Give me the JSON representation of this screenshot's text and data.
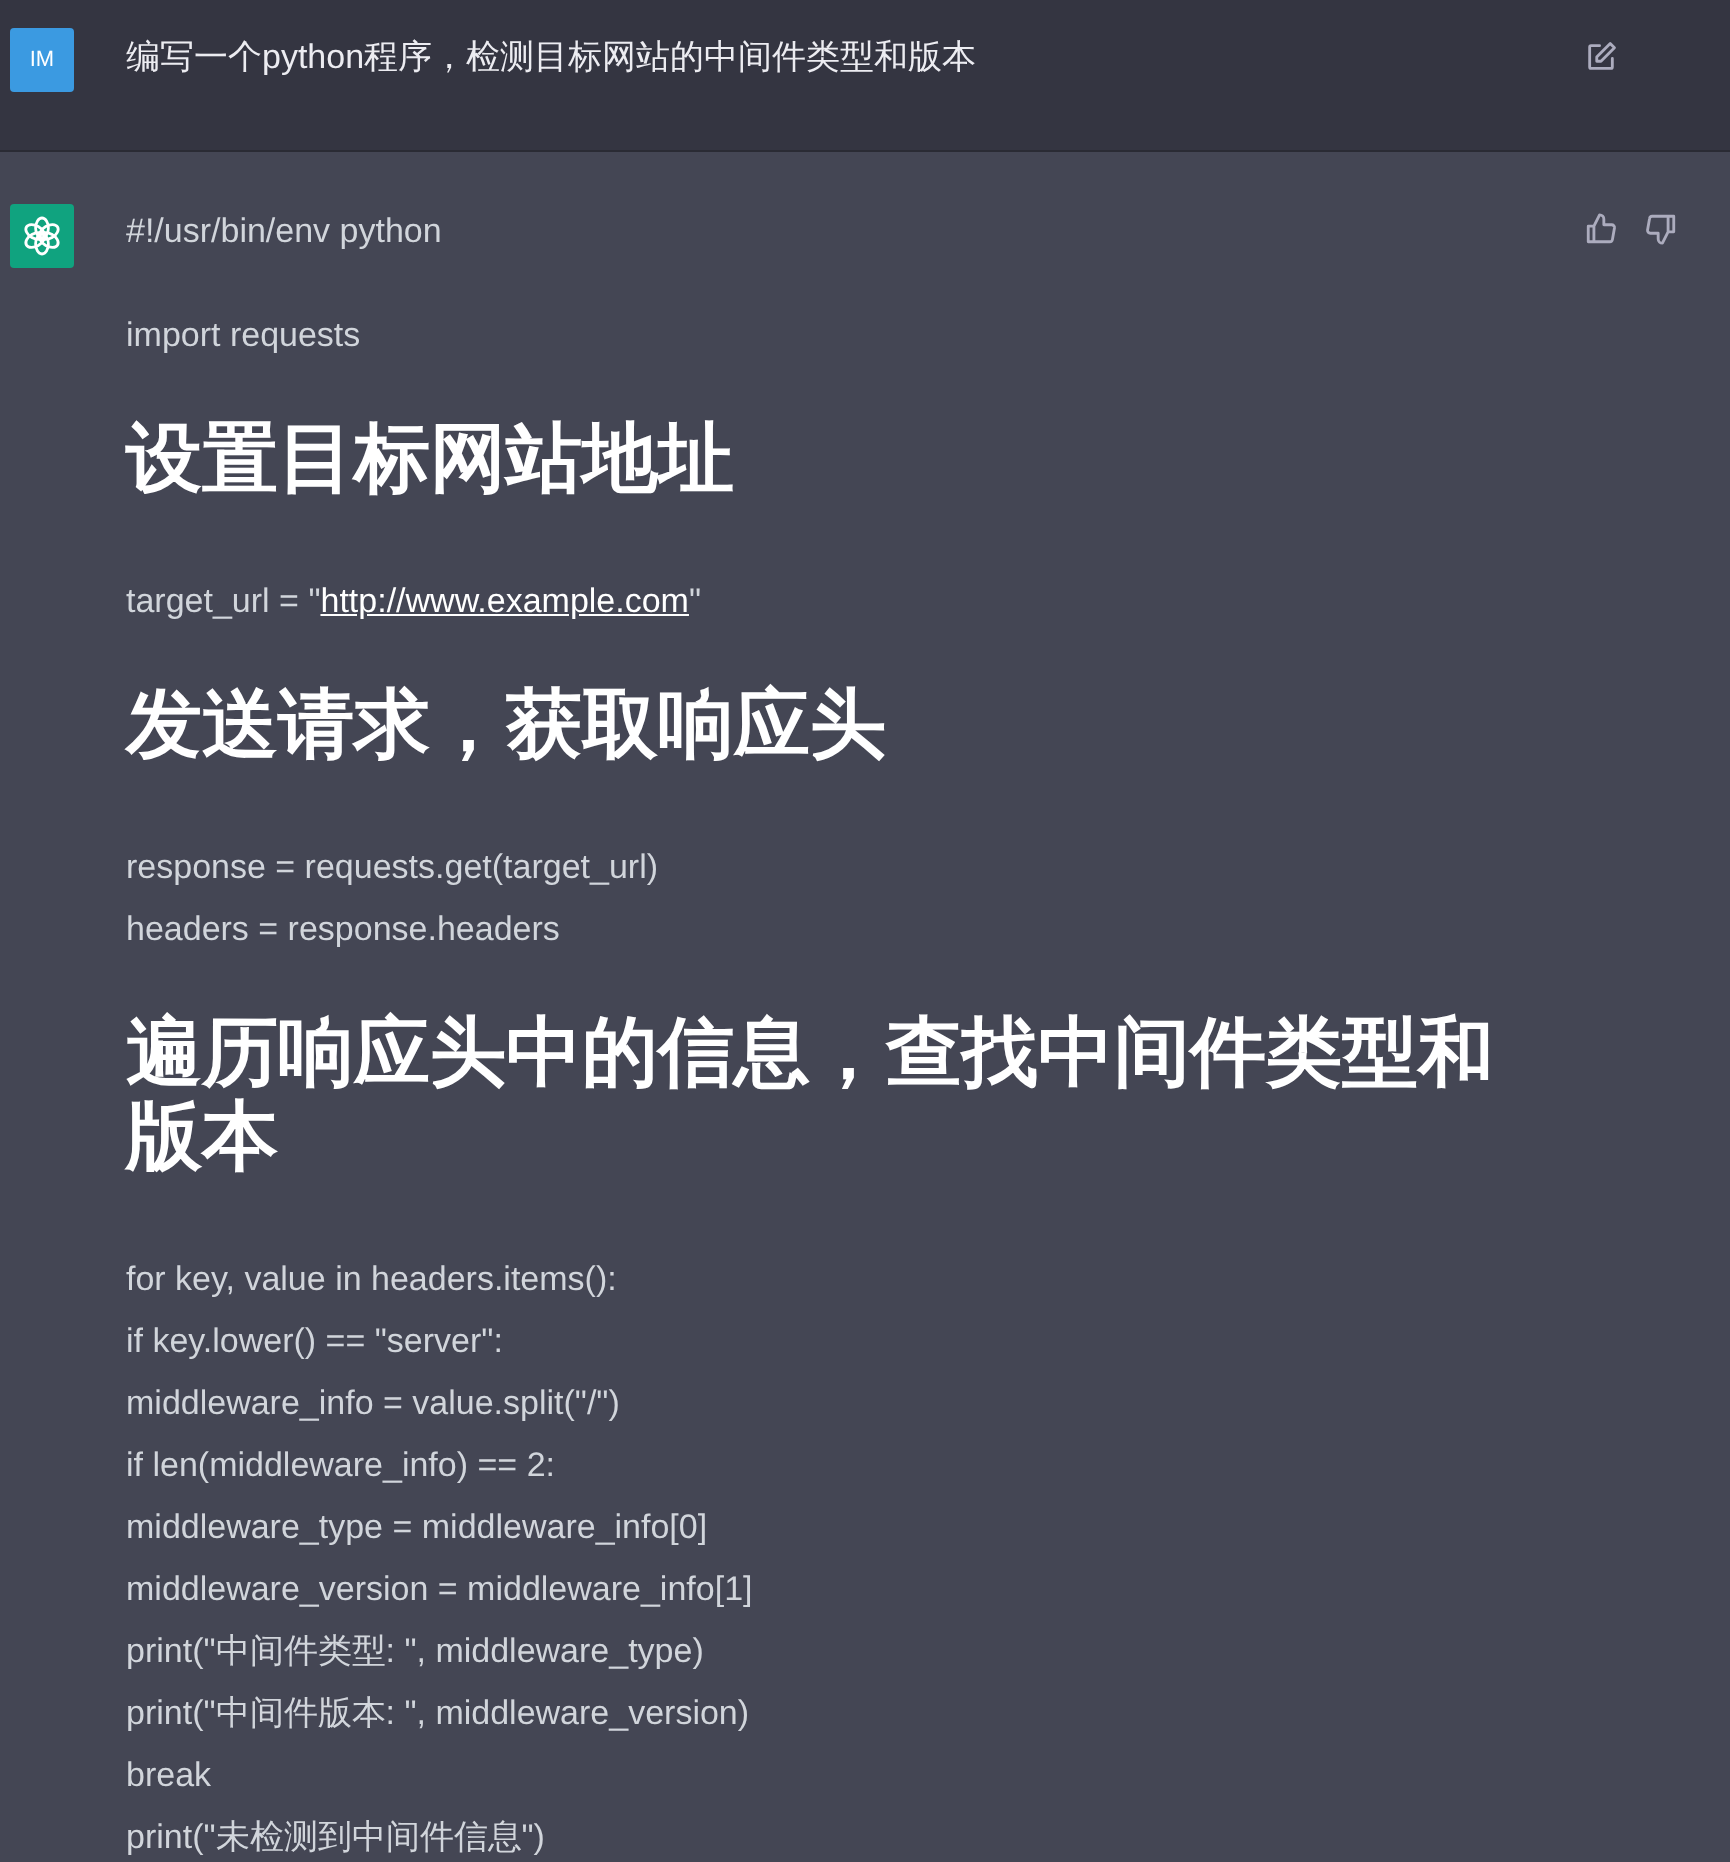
{
  "user_message": {
    "avatar": "IM",
    "text": "编写一个python程序，检测目标网站的中间件类型和版本"
  },
  "assistant_message": {
    "blocks": [
      {
        "kind": "paragraph",
        "lines": [
          [
            {
              "text": "#!/usr/bin/env python"
            }
          ]
        ]
      },
      {
        "kind": "paragraph",
        "lines": [
          [
            {
              "text": "import requests"
            }
          ]
        ]
      },
      {
        "kind": "heading",
        "text": "设置目标网站地址"
      },
      {
        "kind": "paragraph",
        "lines": [
          [
            {
              "text": "target_url = \""
            },
            {
              "text": "http://www.example.com",
              "link": true
            },
            {
              "text": "\""
            }
          ]
        ]
      },
      {
        "kind": "heading",
        "text": "发送请求，获取响应头"
      },
      {
        "kind": "paragraph",
        "lines": [
          [
            {
              "text": "response = requests.get(target_url)"
            }
          ],
          [
            {
              "text": "headers = response.headers"
            }
          ]
        ]
      },
      {
        "kind": "heading",
        "text": "遍历响应头中的信息，查找中间件类型和版本"
      },
      {
        "kind": "paragraph",
        "lines": [
          [
            {
              "text": "for key, value in headers.items():"
            }
          ],
          [
            {
              "text": "if key.lower() == \"server\":"
            }
          ],
          [
            {
              "text": "middleware_info = value.split(\"/\")"
            }
          ],
          [
            {
              "text": "if len(middleware_info) == 2:"
            }
          ],
          [
            {
              "text": "middleware_type = middleware_info[0]"
            }
          ],
          [
            {
              "text": "middleware_version = middleware_info[1]"
            }
          ],
          [
            {
              "text": "print(\"中间件类型: \", middleware_type)"
            }
          ],
          [
            {
              "text": "print(\"中间件版本: \", middleware_version)"
            }
          ],
          [
            {
              "text": "break"
            }
          ],
          [
            {
              "text": "print(\"未检测到中间件信息\")"
            }
          ]
        ]
      }
    ]
  }
}
